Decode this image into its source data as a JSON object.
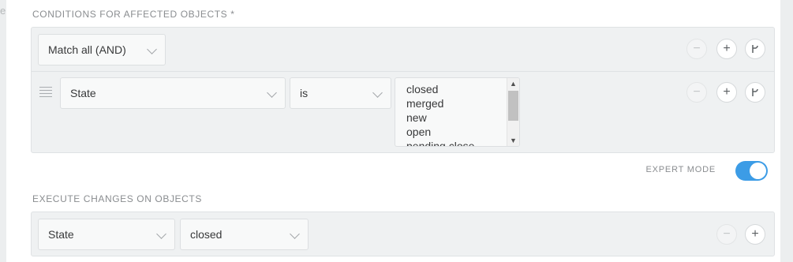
{
  "side_fragment": "e",
  "conditions": {
    "title": "CONDITIONS FOR AFFECTED OBJECTS *",
    "match_select": "Match all (AND)",
    "attribute_select": "State",
    "operator_select": "is",
    "value_options": [
      "closed",
      "merged",
      "new",
      "open",
      "pending close"
    ]
  },
  "expert_mode": {
    "label": "EXPERT MODE",
    "enabled": true
  },
  "execute": {
    "title": "EXECUTE CHANGES ON OBJECTS",
    "attribute_select": "State",
    "value_select": "closed"
  },
  "icons": {
    "remove": "minus-icon",
    "add": "plus-icon",
    "subclause": "branch-icon",
    "drag": "drag-handle-icon"
  },
  "colors": {
    "toggle_on": "#3c9ce6",
    "box_bg": "#eff1f2",
    "page_bg": "#eceeef"
  }
}
